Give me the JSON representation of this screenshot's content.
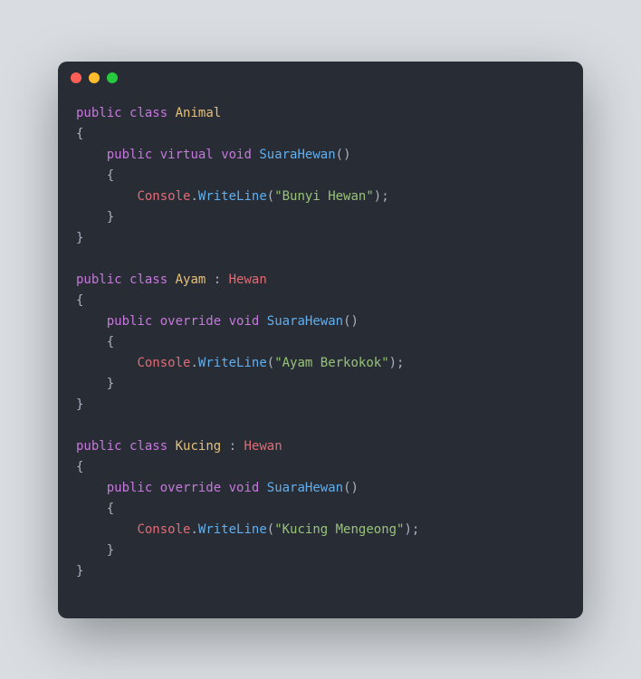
{
  "code": {
    "line1": {
      "kw1": "public",
      "kw2": "class",
      "cls": "Animal"
    },
    "line2": "{",
    "line3": {
      "indent": "    ",
      "kw1": "public",
      "kw2": "virtual",
      "type": "void",
      "fn": "SuaraHewan",
      "paren": "()"
    },
    "line4": "    {",
    "line5": {
      "indent": "        ",
      "obj": "Console",
      "dot": ".",
      "method": "WriteLine",
      "open": "(",
      "str": "\"Bunyi Hewan\"",
      "close": ");"
    },
    "line6": "    }",
    "line7": "}",
    "line8": "",
    "line9": {
      "kw1": "public",
      "kw2": "class",
      "cls": "Ayam",
      "colon": " : ",
      "base": "Hewan"
    },
    "line10": "{",
    "line11": {
      "indent": "    ",
      "kw1": "public",
      "kw2": "override",
      "type": "void",
      "fn": "SuaraHewan",
      "paren": "()"
    },
    "line12": "    {",
    "line13": {
      "indent": "        ",
      "obj": "Console",
      "dot": ".",
      "method": "WriteLine",
      "open": "(",
      "str": "\"Ayam Berkokok\"",
      "close": ");"
    },
    "line14": "    }",
    "line15": "}",
    "line16": "",
    "line17": {
      "kw1": "public",
      "kw2": "class",
      "cls": "Kucing",
      "colon": " : ",
      "base": "Hewan"
    },
    "line18": "{",
    "line19": {
      "indent": "    ",
      "kw1": "public",
      "kw2": "override",
      "type": "void",
      "fn": "SuaraHewan",
      "paren": "()"
    },
    "line20": "    {",
    "line21": {
      "indent": "        ",
      "obj": "Console",
      "dot": ".",
      "method": "WriteLine",
      "open": "(",
      "str": "\"Kucing Mengeong\"",
      "close": ");"
    },
    "line22": "    }",
    "line23": "}"
  }
}
